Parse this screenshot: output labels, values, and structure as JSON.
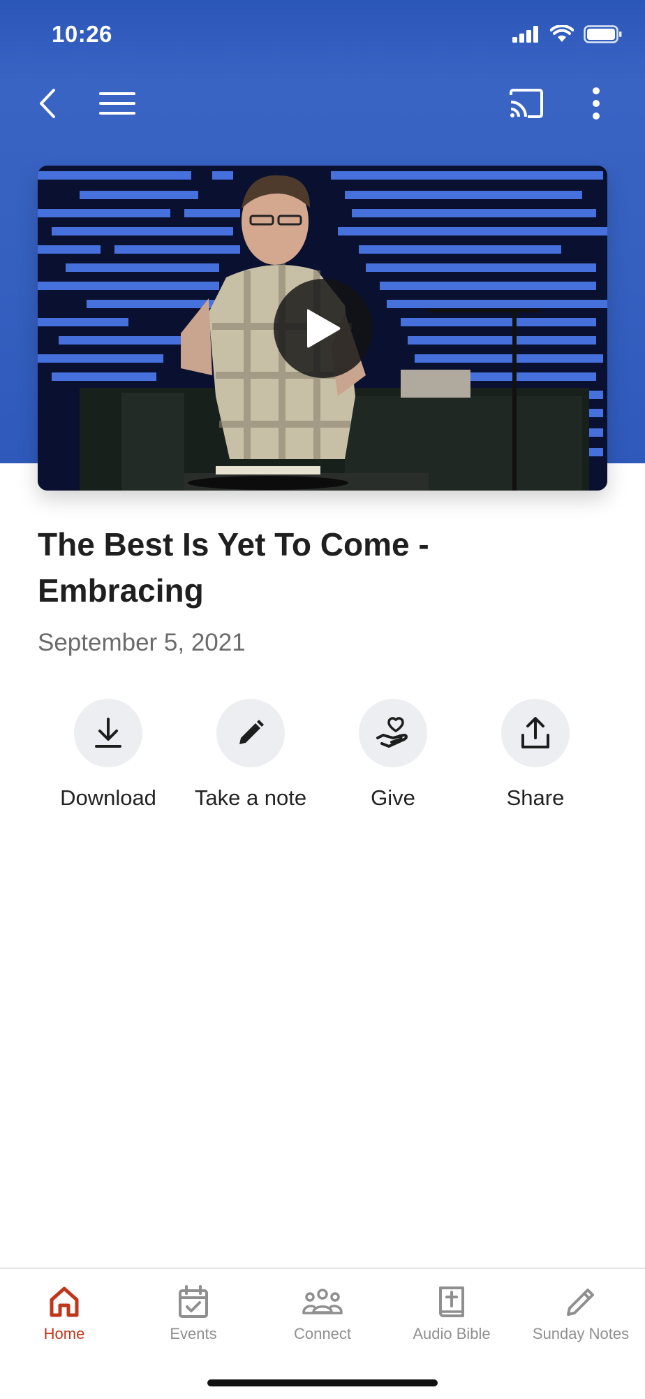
{
  "status_bar": {
    "time": "10:26"
  },
  "toolbar": {
    "back_icon": "chevron-left-icon",
    "menu_icon": "hamburger-icon",
    "cast_icon": "cast-icon",
    "more_icon": "more-vertical-icon"
  },
  "video": {
    "play_icon": "play-icon"
  },
  "sermon": {
    "title": "The Best Is Yet To Come - Embracing",
    "date": "September 5, 2021"
  },
  "actions": [
    {
      "label": "Download",
      "icon": "download-icon"
    },
    {
      "label": "Take a note",
      "icon": "pencil-icon"
    },
    {
      "label": "Give",
      "icon": "heart-hand-icon"
    },
    {
      "label": "Share",
      "icon": "share-icon"
    }
  ],
  "tabs": [
    {
      "label": "Home",
      "icon": "home-icon",
      "active": true
    },
    {
      "label": "Events",
      "icon": "calendar-check-icon",
      "active": false
    },
    {
      "label": "Connect",
      "icon": "people-icon",
      "active": false
    },
    {
      "label": "Audio Bible",
      "icon": "bible-icon",
      "active": false
    },
    {
      "label": "Sunday Notes",
      "icon": "pencil-icon",
      "active": false
    }
  ],
  "colors": {
    "header_blue": "#3560c0",
    "accent_active": "#c0361b",
    "tab_inactive": "#8f8f8f",
    "action_circle": "#eceef1"
  }
}
